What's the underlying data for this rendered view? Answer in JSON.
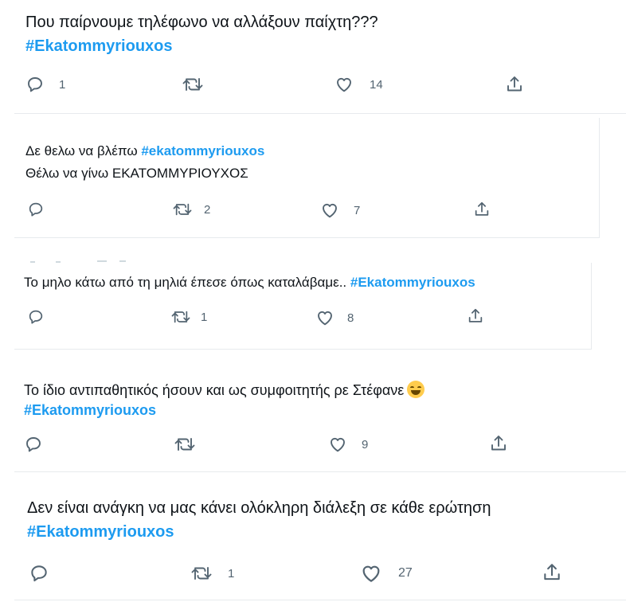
{
  "tweets": [
    {
      "text": "Που παίρνουμε τηλέφωνο να αλλάξουν παίχτη???",
      "hashtag": "#Ekatommyriouxos",
      "replies": "1",
      "retweets": "",
      "likes": "14"
    },
    {
      "text": "Δε θελω να βλέπω ",
      "hashtag": "#ekatommyriouxos",
      "text2": "Θέλω να γίνω ΕΚΑΤΟΜΜΥΡΙΟΥΧΟΣ",
      "replies": "",
      "retweets": "2",
      "likes": "7"
    },
    {
      "text": "Το μηλο κάτω από τη μηλιά έπεσε όπως καταλάβαμε.. ",
      "hashtag": "#Ekatommyriouxos",
      "replies": "",
      "retweets": "1",
      "likes": "8"
    },
    {
      "text": "Το ίδιο αντιπαθητικός ήσουν και ως συμφοιτητής ρε Στέφανε",
      "emoji": "joy-emoji",
      "hashtag": "#Ekatommyriouxos",
      "replies": "",
      "retweets": "",
      "likes": "9"
    },
    {
      "text": "Δεν είναι ανάγκη να μας κάνει ολόκληρη διάλεξη σε κάθε ερώτηση",
      "hashtag": "#Ekatommyriouxos",
      "replies": "",
      "retweets": "1",
      "likes": "27"
    }
  ],
  "colors": {
    "hashtag": "#1d9bf0",
    "icon": "#536471",
    "text": "#0f1419"
  },
  "icons": {
    "reply": "reply-icon",
    "retweet": "retweet-icon",
    "like": "like-icon",
    "share": "share-icon"
  }
}
